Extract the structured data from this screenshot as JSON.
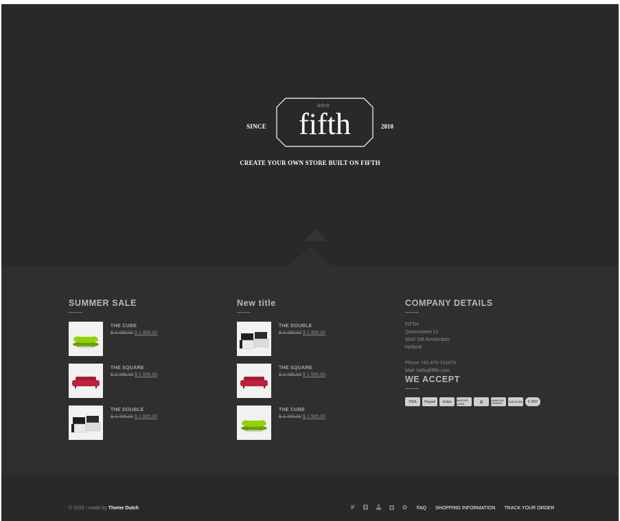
{
  "hero": {
    "since": "SINCE",
    "brand": "fifth",
    "stars": "☆☆☆",
    "year": "2010",
    "tagline": "CREATE YOUR OWN STORE BUILT ON FIFTH"
  },
  "summer_sale": {
    "title": "SUMMER SALE",
    "products": [
      {
        "name": "THE CUBE",
        "old_price": "$ 2.495,00",
        "new_price": "$ 1.995,00",
        "image": "green-sofa"
      },
      {
        "name": "THE SQUARE",
        "old_price": "$ 2.495,00",
        "new_price": "$ 1.995,00",
        "image": "red-sofa"
      },
      {
        "name": "THE DOUBLE",
        "old_price": "$ 2.495,00",
        "new_price": "$ 1.995,00",
        "image": "black-white-sofa"
      }
    ]
  },
  "new_title": {
    "title": "New title",
    "products": [
      {
        "name": "THE DOUBLE",
        "old_price": "$ 2.495,00",
        "new_price": "$ 1.995,00",
        "image": "black-white-sofa"
      },
      {
        "name": "THE SQUARE",
        "old_price": "$ 2.495,00",
        "new_price": "$ 1.995,00",
        "image": "red-sofa"
      },
      {
        "name": "THE CUBE",
        "old_price": "$ 2.495,00",
        "new_price": "$ 1.995,00",
        "image": "green-sofa"
      }
    ]
  },
  "company": {
    "title": "COMPANY DETAILS",
    "name": "FIFTH",
    "street": "Queenstreet 12",
    "city": "6042 GB Amsterdam",
    "country": "Holland",
    "phone": "Phone +31-475-741673",
    "mail": "Mail: hello@fifth.com",
    "accept_title": "WE ACCEPT",
    "cards": [
      "VISA",
      "Paypal",
      "stripe",
      "MASTER CARD",
      "a",
      "AMERICAN EXPRESS",
      "DISCOVER",
      "C PAY"
    ]
  },
  "footer": {
    "copy_prefix": "© 2015 - made by",
    "copy_link": "Theme Dutch",
    "social_icons": [
      "twitter-icon",
      "facebook-icon",
      "youtube-icon",
      "instagram-icon",
      "pinterest-icon"
    ],
    "links": [
      "FAQ",
      "SHOPPING INFORMATION",
      "TRACK YOUR ORDER"
    ]
  },
  "colors": {
    "background": "#292929",
    "panel": "#2f2f2f",
    "green_sofa": "#8fd400",
    "red_sofa": "#c0203a"
  }
}
